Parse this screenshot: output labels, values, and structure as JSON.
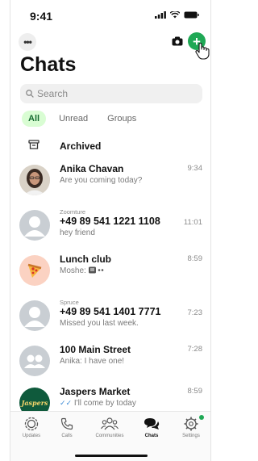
{
  "status_bar": {
    "time": "9:41"
  },
  "title": "Chats",
  "search": {
    "placeholder": "Search"
  },
  "filters": [
    "All",
    "Unread",
    "Groups"
  ],
  "archived_label": "Archived",
  "chats": [
    {
      "sub": "",
      "name": "Anika Chavan",
      "preview": "Are you coming today?",
      "time": "9:34"
    },
    {
      "sub": "Zoomture",
      "name": "+49 89 541 1221 1108",
      "preview": "hey friend",
      "time": "11:01"
    },
    {
      "sub": "",
      "name": "Lunch club",
      "preview": "Moshe:",
      "time": "8:59"
    },
    {
      "sub": "Spruce",
      "name": "+49 89 541 1401 7771",
      "preview": "Missed you last week.",
      "time": "7:23"
    },
    {
      "sub": "",
      "name": "100 Main Street",
      "preview": "Anika: I have one!",
      "time": "7:28"
    },
    {
      "sub": "",
      "name": "Jaspers Market",
      "preview": "I'll come by today",
      "time": "8:59"
    }
  ],
  "jaspers_logo_text": "Jaspers",
  "tabs": [
    {
      "label": "Updates",
      "icon": "updates-icon"
    },
    {
      "label": "Calls",
      "icon": "phone-icon"
    },
    {
      "label": "Communities",
      "icon": "communities-icon"
    },
    {
      "label": "Chats",
      "icon": "chats-icon"
    },
    {
      "label": "Settings",
      "icon": "settings-icon"
    }
  ],
  "colors": {
    "accent": "#1fa855",
    "active_chip_bg": "#d9fdd3",
    "read_tick": "#3d8bd6"
  }
}
